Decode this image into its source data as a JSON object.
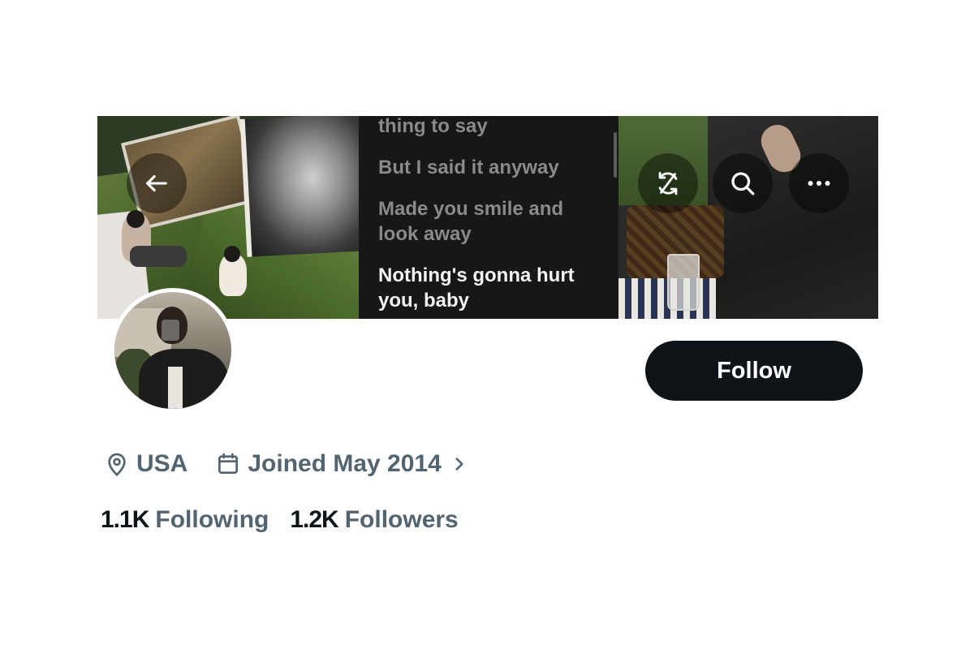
{
  "banner": {
    "lyrics": [
      {
        "text": "thing to say",
        "style": "dim"
      },
      {
        "text": "But I said it anyway",
        "style": "dim"
      },
      {
        "text": "Made you smile and",
        "style": "dim"
      },
      {
        "text": "look away",
        "style": "dim"
      },
      {
        "text": "Nothing's gonna hurt",
        "style": "bright"
      },
      {
        "text": "you, baby",
        "style": "bright"
      }
    ]
  },
  "header": {
    "icons": {
      "back": "arrow-left-icon",
      "sync": "sync-off-icon",
      "search": "search-icon",
      "more": "more-icon"
    }
  },
  "profile": {
    "follow_label": "Follow",
    "location": "USA",
    "joined": "Joined May 2014",
    "following_count": "1.1K",
    "following_label": "Following",
    "followers_count": "1.2K",
    "followers_label": "Followers"
  },
  "colors": {
    "primary_text": "#0f1419",
    "secondary_text": "#536471",
    "follow_bg": "#0f1419"
  }
}
